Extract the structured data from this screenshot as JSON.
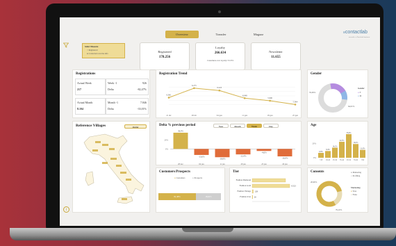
{
  "tabs": [
    {
      "label": "Overview",
      "active": true
    },
    {
      "label": "Transfer",
      "active": false
    },
    {
      "label": "Magazz",
      "active": false
    }
  ],
  "logo": {
    "text": "contactlab",
    "tagline": "accendi e a Zucchetti business"
  },
  "filter": {
    "title": "Select Measure",
    "options": [
      "Registered",
      "Contacted over the info"
    ]
  },
  "kpis": [
    {
      "label": "Registered",
      "value": "178.256"
    },
    {
      "label": "Loyalty",
      "value": "266.634",
      "sub": "Customers over loyalty: 53.374"
    },
    {
      "label": "Newsletter",
      "value": "11.655"
    }
  ],
  "registrations": {
    "title": "Registrations",
    "rows": [
      {
        "a_label": "Actual Week",
        "a_val": "217",
        "b_label": "Week -1",
        "b_pct": "Delta",
        "b_val": "926",
        "b_pct_val": "-82,47%"
      },
      {
        "a_label": "Actual Month",
        "a_val": "8.104",
        "b_label": "Month -1",
        "b_pct": "Delta",
        "b_val": "7.846",
        "b_pct_val": "-33,01%"
      }
    ]
  },
  "trend": {
    "title": "Registration Trend"
  },
  "gender": {
    "title": "Gender",
    "legend_title": "Gender",
    "legend": [
      "F",
      "M"
    ],
    "pct_left": "35,09%",
    "pct_right": "64,91%"
  },
  "villages": {
    "title": "Reference Villages",
    "button": "Outlet"
  },
  "delta": {
    "title": "Delta % previous period",
    "buttons": [
      "Year",
      "Month",
      "Week",
      "Day"
    ],
    "active": "Week"
  },
  "age": {
    "title": "Age"
  },
  "customers": {
    "title": "Customers/Prospects",
    "legend": [
      "Customers",
      "Prospects"
    ],
    "bar_left": "81,38%",
    "bar_right": "18,62%"
  },
  "tier": {
    "title": "Tier"
  },
  "consents": {
    "title": "Consents",
    "legend_top": [
      "Marketing",
      "Profiling"
    ],
    "legend_sub_title": "Marketing",
    "legend_sub": [
      "True",
      "False"
    ],
    "pct_left": "20,90%",
    "pct_right": "79,10%"
  },
  "colors": {
    "gold": "#d4b24a",
    "orange": "#e06c3a",
    "purple": "#b58ce0",
    "blue": "#8fb6e6"
  },
  "chart_data": [
    {
      "type": "line",
      "title": "Registration Trend",
      "x": [
        "21 dic",
        "28 dic",
        "04 gen",
        "11 gen",
        "18 gen",
        "25 gen"
      ],
      "values": [
        6.061,
        6.275,
        6.223,
        6.048,
        5.99,
        5.904
      ],
      "labels": [
        "6.061",
        "6.275",
        "6.223",
        "6.048",
        "5.990",
        "5.904"
      ]
    },
    {
      "type": "bar",
      "title": "Delta % previous period",
      "x": [
        "28 dec",
        "04 jan",
        "11 jan",
        "18 jan",
        "25 jan",
        "29 jan"
      ],
      "values": [
        36.9,
        -13.6,
        -18.8,
        -12.4,
        -4.6,
        -16.9
      ],
      "labels": [
        "36,9%",
        "-13,6%",
        "-18,8%",
        "-12,4%",
        "-4,6%",
        "-16,9%"
      ],
      "ylim": [
        -20,
        40
      ]
    },
    {
      "type": "bar",
      "title": "Age",
      "categories": [
        "<18",
        "18-24",
        "25-34",
        "35-44",
        "45-54",
        "55-64",
        ">64"
      ],
      "values": [
        6.8,
        9.4,
        14.1,
        22.3,
        33.0,
        19.2,
        11.0
      ],
      "labels": [
        "6,8%",
        "9,4%",
        "14,1%",
        "22,3%",
        "33,0%",
        "19,2%",
        "11,0%"
      ]
    },
    {
      "type": "bar",
      "title": "Tier",
      "categories": [
        "Fashion Diamond",
        "Fashion Gold",
        "Fashion Vintage",
        "Fashion Icon"
      ],
      "values": [
        4.0,
        4.5,
        0.13,
        0.03
      ],
      "labels": [
        "",
        "4.523",
        "128",
        "26"
      ]
    }
  ]
}
